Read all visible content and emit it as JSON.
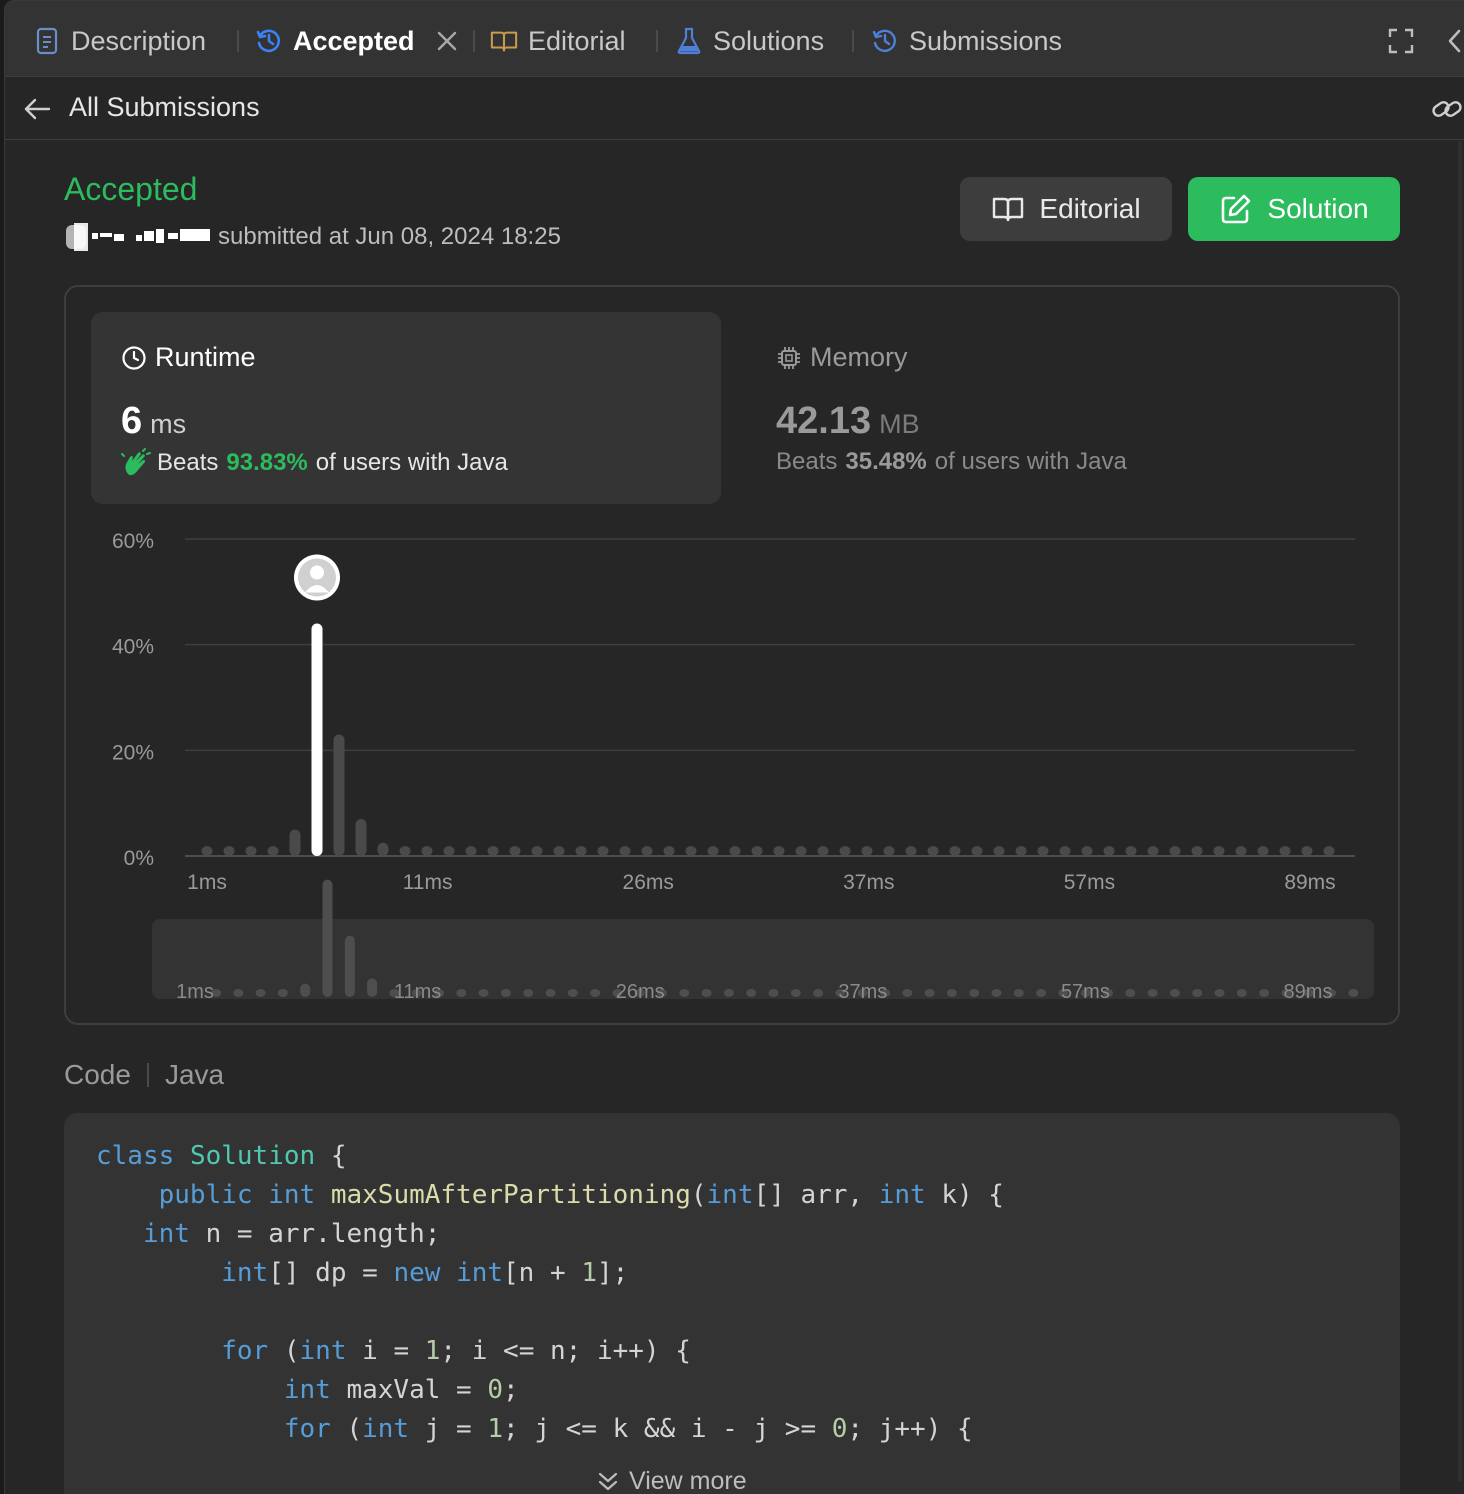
{
  "tabs": [
    {
      "label": "Description",
      "icon": "description-icon"
    },
    {
      "label": "Accepted",
      "icon": "history-icon",
      "active": true,
      "closable": true
    },
    {
      "label": "Editorial",
      "icon": "book-icon"
    },
    {
      "label": "Solutions",
      "icon": "flask-icon"
    },
    {
      "label": "Submissions",
      "icon": "history-icon"
    }
  ],
  "subheader": {
    "title": "All Submissions"
  },
  "submission": {
    "status": "Accepted",
    "submitted_text": "submitted at Jun 08, 2024 18:25"
  },
  "actions": {
    "editorial_label": "Editorial",
    "solution_label": "Solution"
  },
  "runtime": {
    "title": "Runtime",
    "value": "6",
    "unit": "ms",
    "beats_label": "Beats",
    "beats_pct": "93.83%",
    "beats_suffix": "of users with Java"
  },
  "memory": {
    "title": "Memory",
    "value": "42.13",
    "unit": "MB",
    "beats_label": "Beats",
    "beats_pct": "35.48%",
    "beats_suffix": "of users with Java"
  },
  "chart_data": {
    "type": "bar",
    "title": "",
    "xlabel": "",
    "ylabel": "",
    "ylim": [
      0,
      60
    ],
    "y_ticks": [
      "60%",
      "40%",
      "20%",
      "0%"
    ],
    "x_tick_labels": [
      "1ms",
      "11ms",
      "26ms",
      "37ms",
      "57ms",
      "89ms"
    ],
    "values": [
      0.3,
      0.3,
      0.3,
      0.3,
      5,
      44,
      23,
      7,
      2.5,
      0.3,
      0.3,
      0.3,
      0.3,
      0.3,
      0.3,
      0.3,
      0.3,
      0.3,
      0.3,
      0.3,
      0.3,
      0.3,
      0.3,
      0.3,
      0.3,
      0.3,
      0.3,
      0.3,
      0.3,
      0.3,
      0.3,
      0.3,
      0.3,
      0.3,
      0.3,
      0.3,
      0.3,
      0.3,
      0.3,
      0.3,
      0.3,
      0.3,
      0.3,
      0.3,
      0.3,
      0.3,
      0.3,
      0.3,
      0.3,
      0.3,
      0.3,
      0.3
    ],
    "highlight_index": 5,
    "grid": true,
    "overview_x_tick_labels": [
      "1ms",
      "11ms",
      "26ms",
      "37ms",
      "57ms",
      "89ms"
    ]
  },
  "code": {
    "header_label": "Code",
    "language": "Java",
    "view_more": "View more",
    "lines": [
      "class Solution {",
      "    public int maxSumAfterPartitioning(int[] arr, int k) {",
      "   int n = arr.length;",
      "        int[] dp = new int[n + 1];",
      "",
      "        for (int i = 1; i <= n; i++) {",
      "            int maxVal = 0;",
      "            for (int j = 1; j <= k && i - j >= 0; j++) {"
    ]
  },
  "colors": {
    "accent_green": "#2cbb5d",
    "tab_blue": "#3b82f6",
    "book_orange": "#c99a4b"
  }
}
